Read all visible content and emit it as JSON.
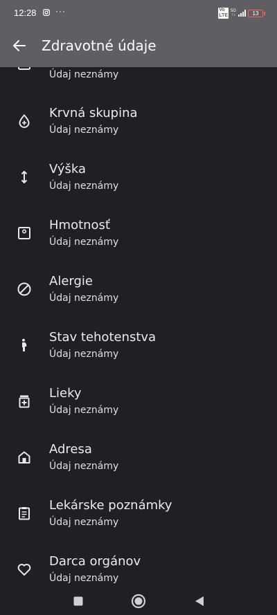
{
  "status_bar": {
    "time": "12:28",
    "notification_icons": [
      "instagram-icon",
      "more-dots"
    ],
    "more_label": "···",
    "volte_label": "Vo\nLTE",
    "network_label": "5G",
    "network_sub_label": "↑↓",
    "battery_level": "13",
    "battery_color": "#ff5b5b"
  },
  "app_bar": {
    "back_icon": "arrow-left-icon",
    "title": "Zdravotné údaje",
    "background": "#5f5f63"
  },
  "items": [
    {
      "label": "",
      "value": "Údaj neznámy",
      "icon": "scale-icon"
    },
    {
      "label": "Krvná skupina",
      "value": "Údaj neznámy",
      "icon": "blood-drop-icon"
    },
    {
      "label": "Výška",
      "value": "Údaj neznámy",
      "icon": "height-arrows-icon"
    },
    {
      "label": "Hmotnosť",
      "value": "Údaj neznámy",
      "icon": "scale-icon"
    },
    {
      "label": "Alergie",
      "value": "Údaj neznámy",
      "icon": "block-icon"
    },
    {
      "label": "Stav tehotenstva",
      "value": "Údaj neznámy",
      "icon": "pregnancy-icon"
    },
    {
      "label": "Lieky",
      "value": "Údaj neznámy",
      "icon": "medication-icon"
    },
    {
      "label": "Adresa",
      "value": "Údaj neznámy",
      "icon": "home-icon"
    },
    {
      "label": "Lekárske poznámky",
      "value": "Údaj neznámy",
      "icon": "clipboard-icon"
    },
    {
      "label": "Darca orgánov",
      "value": "Údaj neznámy",
      "icon": "heart-icon"
    }
  ],
  "nav_bar": {
    "buttons": [
      "recents-square-icon",
      "home-circle-icon",
      "back-triangle-icon"
    ]
  },
  "colors": {
    "background": "#1f1f24",
    "text": "#ececef"
  }
}
